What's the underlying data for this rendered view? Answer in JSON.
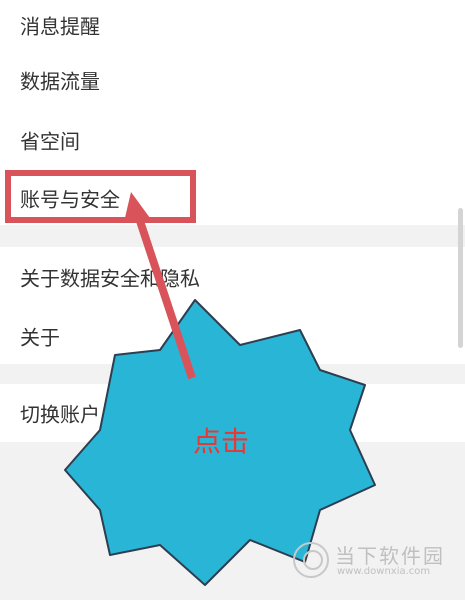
{
  "menu": {
    "items": [
      {
        "label": "消息提醒"
      },
      {
        "label": "数据流量"
      },
      {
        "label": "省空间"
      },
      {
        "label": "账号与安全"
      },
      {
        "label": "关于数据安全和隐私"
      },
      {
        "label": "关于"
      },
      {
        "label": "切换账户"
      }
    ]
  },
  "annotation": {
    "callout_text": "点击",
    "highlight_color": "#d9535b",
    "burst_color": "#29b6d6",
    "text_color": "#e53935"
  },
  "watermark": {
    "title": "当下软件园",
    "url": "www.downxia.com"
  }
}
